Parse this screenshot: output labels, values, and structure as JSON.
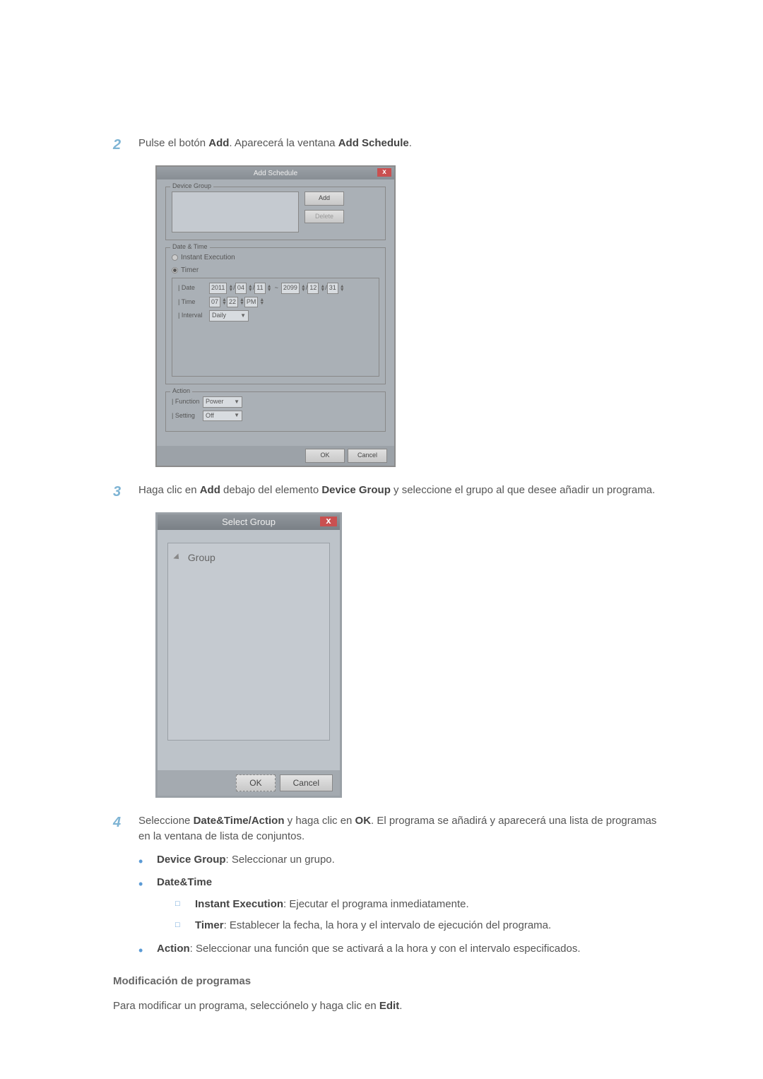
{
  "step2": {
    "num": "2",
    "pre": "Pulse el botón ",
    "b1": "Add",
    "mid": ". Aparecerá la ventana ",
    "b2": "Add Schedule",
    "post": "."
  },
  "addSchedule": {
    "title": "Add Schedule",
    "close": "x",
    "deviceGroup": {
      "label": "Device Group",
      "add": "Add",
      "delete": "Delete"
    },
    "dateTime": {
      "label": "Date & Time",
      "instant": "Instant Execution",
      "timer": "Timer",
      "dateLabel": "| Date",
      "y1": "2011",
      "m1": "04",
      "d1": "11",
      "sep": "~",
      "y2": "2099",
      "m2": "12",
      "d2": "31",
      "slash": "/",
      "timeLabel": "| Time",
      "hh": "07",
      "mm": "22",
      "ap": "PM",
      "intervalLabel": "| Interval",
      "interval": "Daily"
    },
    "action": {
      "label": "Action",
      "functionLabel": "| Function",
      "function": "Power",
      "settingLabel": "| Setting",
      "setting": "Off"
    },
    "ok": "OK",
    "cancel": "Cancel"
  },
  "step3": {
    "num": "3",
    "pre": "Haga clic en ",
    "b1": "Add",
    "mid1": " debajo del elemento ",
    "b2": "Device Group",
    "mid2": " y seleccione el grupo al que desee añadir un programa."
  },
  "selectGroup": {
    "title": "Select Group",
    "close": "x",
    "root": "Group",
    "ok": "OK",
    "cancel": "Cancel"
  },
  "step4": {
    "num": "4",
    "pre": "Seleccione ",
    "b1": "Date&Time/Action",
    "mid1": " y haga clic en ",
    "b2": "OK",
    "mid2": ". El programa se añadirá y aparecerá una lista de programas en la ventana de lista de conjuntos."
  },
  "bullets": {
    "dg": {
      "label": "Device Group",
      "text": ": Seleccionar un grupo."
    },
    "dt": {
      "label": "Date&Time"
    },
    "ie": {
      "label": "Instant Execution",
      "text": ": Ejecutar el programa inmediatamente."
    },
    "tm": {
      "label": "Timer",
      "text": ": Establecer la fecha, la hora y el intervalo de ejecución del programa."
    },
    "ac": {
      "label": "Action",
      "text": ": Seleccionar una función que se activará a la hora y con el intervalo especificados."
    }
  },
  "modHead": "Modificación de programas",
  "modText": {
    "pre": "Para modificar un programa, selecciónelo y haga clic en ",
    "b": "Edit",
    "post": "."
  }
}
